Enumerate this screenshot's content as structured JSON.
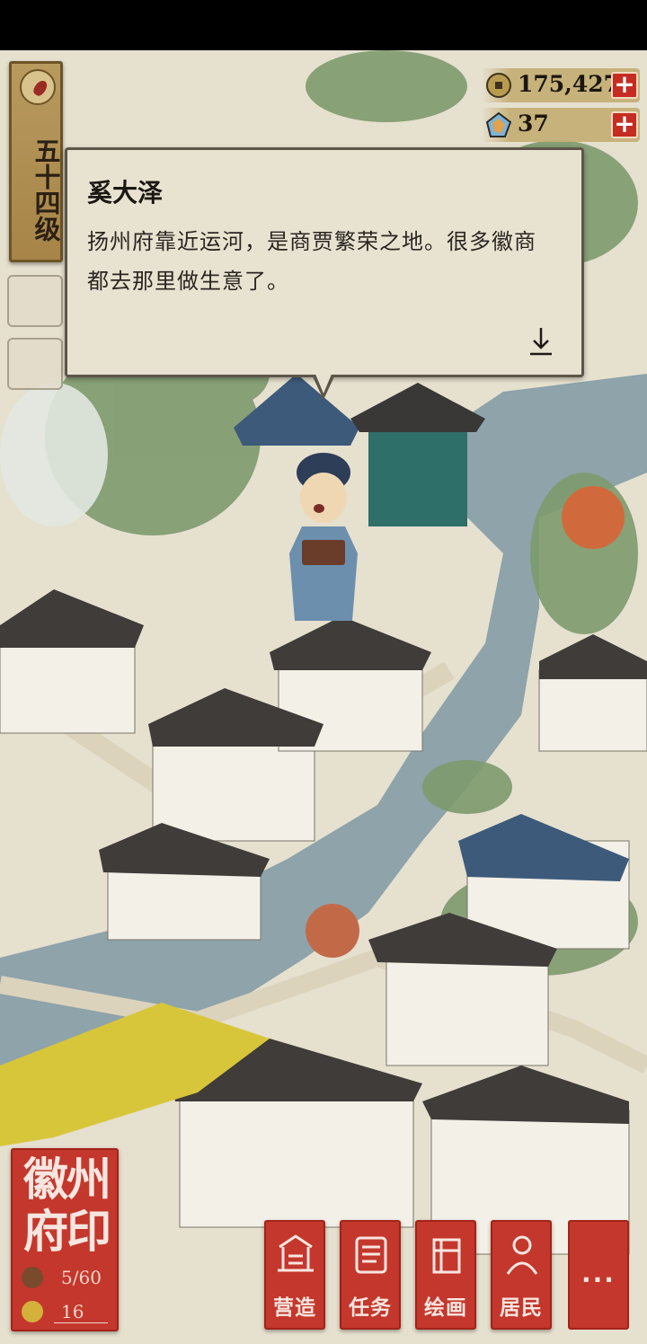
{
  "level": {
    "label": "五十四级"
  },
  "currencies": [
    {
      "icon": "copper-coin-icon",
      "value": "175,427"
    },
    {
      "icon": "jade-gem-icon",
      "value": "37"
    }
  ],
  "dialog": {
    "speaker": "奚大泽",
    "text": "扬州府靠近运河，是商贾繁荣之地。很多徽商都去那里做生意了。"
  },
  "seal": {
    "title": "徽州府印",
    "stats": [
      {
        "icon": "figure-icon",
        "value": "5/60"
      },
      {
        "icon": "gold-ingot-icon",
        "value": "16"
      }
    ]
  },
  "actions": [
    {
      "label": "营造",
      "icon": "build-icon"
    },
    {
      "label": "任务",
      "icon": "scroll-icon"
    },
    {
      "label": "绘画",
      "icon": "painting-icon"
    },
    {
      "label": "居民",
      "icon": "resident-icon"
    }
  ],
  "more_label": "...",
  "colors": {
    "seal_red": "#c4372c",
    "parchment": "#e8e2d1",
    "gold_bar": "#c4b076",
    "water": "#8ea3aa"
  }
}
